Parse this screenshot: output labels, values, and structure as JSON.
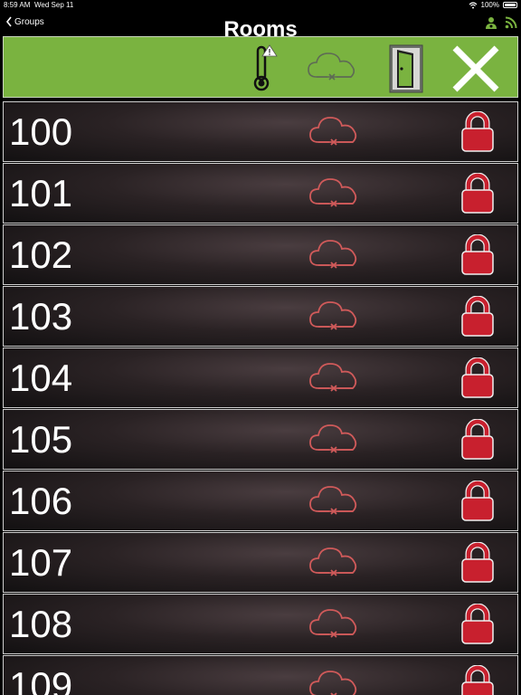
{
  "status_bar": {
    "time": "8:59 AM",
    "date": "Wed Sep 11",
    "battery": "100%"
  },
  "nav": {
    "back_label": "Groups",
    "title": "Rooms"
  },
  "header": {
    "icons": [
      "thermometer-warning-icon",
      "cloud-offline-icon",
      "door-icon",
      "close-icon"
    ]
  },
  "rooms": [
    {
      "number": "100",
      "status": "offline",
      "lock": "locked"
    },
    {
      "number": "101",
      "status": "offline",
      "lock": "locked"
    },
    {
      "number": "102",
      "status": "offline",
      "lock": "locked"
    },
    {
      "number": "103",
      "status": "offline",
      "lock": "locked"
    },
    {
      "number": "104",
      "status": "offline",
      "lock": "locked"
    },
    {
      "number": "105",
      "status": "offline",
      "lock": "locked"
    },
    {
      "number": "106",
      "status": "offline",
      "lock": "locked"
    },
    {
      "number": "107",
      "status": "offline",
      "lock": "locked"
    },
    {
      "number": "108",
      "status": "offline",
      "lock": "locked"
    },
    {
      "number": "109",
      "status": "offline",
      "lock": "locked"
    }
  ],
  "colors": {
    "header_green": "#7ab340",
    "lock_red": "#c8202e",
    "cloud_red": "#d05a5a",
    "accent_green": "#7ab340"
  }
}
